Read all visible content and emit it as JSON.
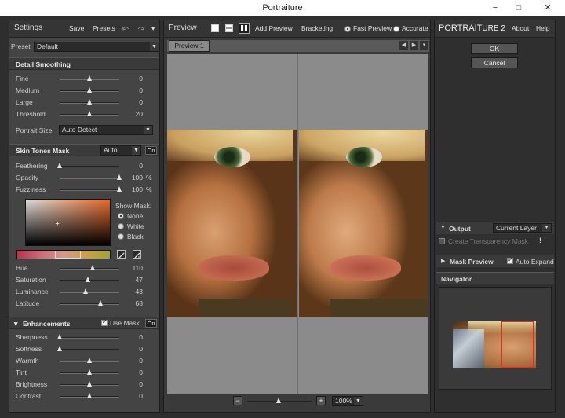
{
  "window": {
    "title": "Portraiture",
    "minimize": "−",
    "maximize": "□",
    "close": "✕"
  },
  "left": {
    "header": {
      "title": "Settings",
      "save": "Save",
      "presets": "Presets",
      "undo_icon": "undo-icon",
      "redo_icon": "redo-icon",
      "menu_icon": "menu-icon"
    },
    "preset": {
      "label": "Preset",
      "value": "Default"
    },
    "detail": {
      "title": "Detail Smoothing",
      "sliders": [
        {
          "label": "Fine",
          "value": "0",
          "level": 0.5
        },
        {
          "label": "Medium",
          "value": "0",
          "level": 0.5
        },
        {
          "label": "Large",
          "value": "0",
          "level": 0.5
        },
        {
          "label": "Threshold",
          "value": "20",
          "level": 0.5
        }
      ],
      "portrait_size": {
        "label": "Portrait Size",
        "value": "Auto Detect"
      }
    },
    "skin": {
      "title": "Skin Tones Mask",
      "mode": "Auto",
      "on": "On",
      "sliders": [
        {
          "label": "Feathering",
          "value": "0",
          "unit": "",
          "level": 0.0
        },
        {
          "label": "Opacity",
          "value": "100",
          "unit": "%",
          "level": 1.0
        },
        {
          "label": "Fuzziness",
          "value": "100",
          "unit": "%",
          "level": 1.0
        }
      ],
      "show_mask": {
        "label": "Show Mask:",
        "options": [
          "None",
          "White",
          "Black"
        ],
        "selected": 0
      },
      "hsl": [
        {
          "label": "Hue",
          "value": "110",
          "level": 0.55
        },
        {
          "label": "Saturation",
          "value": "47",
          "level": 0.47
        },
        {
          "label": "Luminance",
          "value": "43",
          "level": 0.43
        },
        {
          "label": "Latitude",
          "value": "68",
          "level": 0.68
        }
      ]
    },
    "enh": {
      "title": "Enhancements",
      "use_mask": "Use Mask",
      "on": "On",
      "sliders": [
        {
          "label": "Sharpness",
          "value": "0",
          "level": 0.0
        },
        {
          "label": "Softness",
          "value": "0",
          "level": 0.0
        },
        {
          "label": "Warmth",
          "value": "0",
          "level": 0.5
        },
        {
          "label": "Tint",
          "value": "0",
          "level": 0.5
        },
        {
          "label": "Brightness",
          "value": "0",
          "level": 0.5
        },
        {
          "label": "Contrast",
          "value": "0",
          "level": 0.5
        }
      ]
    }
  },
  "center": {
    "header": {
      "title": "Preview",
      "add_preview": "Add Preview",
      "bracketing": "Bracketing",
      "fast_preview": "Fast Preview",
      "accurate": "Accurate"
    },
    "tab": "Preview 1",
    "zoom": {
      "minus": "−",
      "plus": "+",
      "value": "100%"
    }
  },
  "right": {
    "brand_left": "PORTRAIT",
    "brand_right": "URE 2",
    "about": "About",
    "help": "Help",
    "ok": "OK",
    "cancel": "Cancel",
    "output": {
      "title": "Output",
      "value": "Current Layer",
      "transparency": "Create Transparency Mask",
      "warning": "!"
    },
    "mask_preview": {
      "title": "Mask Preview",
      "auto_expand": "Auto Expand"
    },
    "navigator": {
      "title": "Navigator"
    }
  },
  "colors": {
    "panel": "#444444",
    "frame": "#2e2e2e",
    "accent": "#ff2020"
  }
}
